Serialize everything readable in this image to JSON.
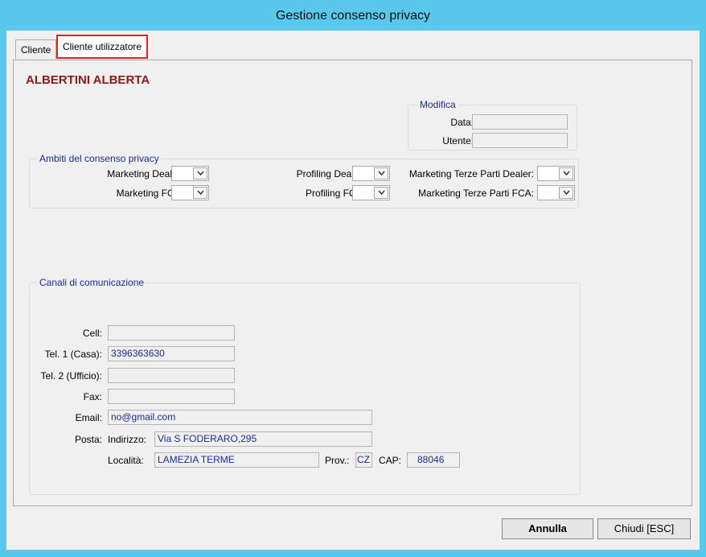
{
  "window": {
    "title": "Gestione consenso privacy"
  },
  "tabs": [
    {
      "label": "Cliente"
    },
    {
      "label": "Cliente utilizzatore"
    }
  ],
  "customer": {
    "name": "ALBERTINI ALBERTA"
  },
  "modifica": {
    "legend": "Modifica",
    "data_label": "Data:",
    "data_value": "",
    "utente_label": "Utente:",
    "utente_value": ""
  },
  "ambiti": {
    "legend": "Ambiti del consenso privacy",
    "marketing_dealer": "Marketing Dealer:",
    "marketing_fca": "Marketing FCA:",
    "profiling_dealer": "Profiling Dealer:",
    "profiling_fca": "Profiling FCA:",
    "terze_dealer": "Marketing Terze Parti Dealer:",
    "terze_fca": "Marketing Terze Parti FCA:"
  },
  "canali": {
    "legend": "Canali di comunicazione",
    "cell_label": "Cell:",
    "cell_value": "",
    "tel1_label": "Tel. 1 (Casa):",
    "tel1_value": "3396363630",
    "tel2_label": "Tel. 2 (Ufficio):",
    "tel2_value": "",
    "fax_label": "Fax:",
    "fax_value": "",
    "email_label": "Email:",
    "email_value": "no@gmail.com",
    "posta_label": "Posta:",
    "indirizzo_label": "Indirizzo:",
    "indirizzo_value": "Via S FODERARO,295",
    "localita_label": "Località:",
    "localita_value": "LAMEZIA TERME",
    "prov_label": "Prov.:",
    "prov_value": "CZ",
    "cap_label": "CAP:",
    "cap_value": "88046"
  },
  "buttons": {
    "annulla": "Annulla",
    "chiudi": "Chiudi [ESC]"
  }
}
